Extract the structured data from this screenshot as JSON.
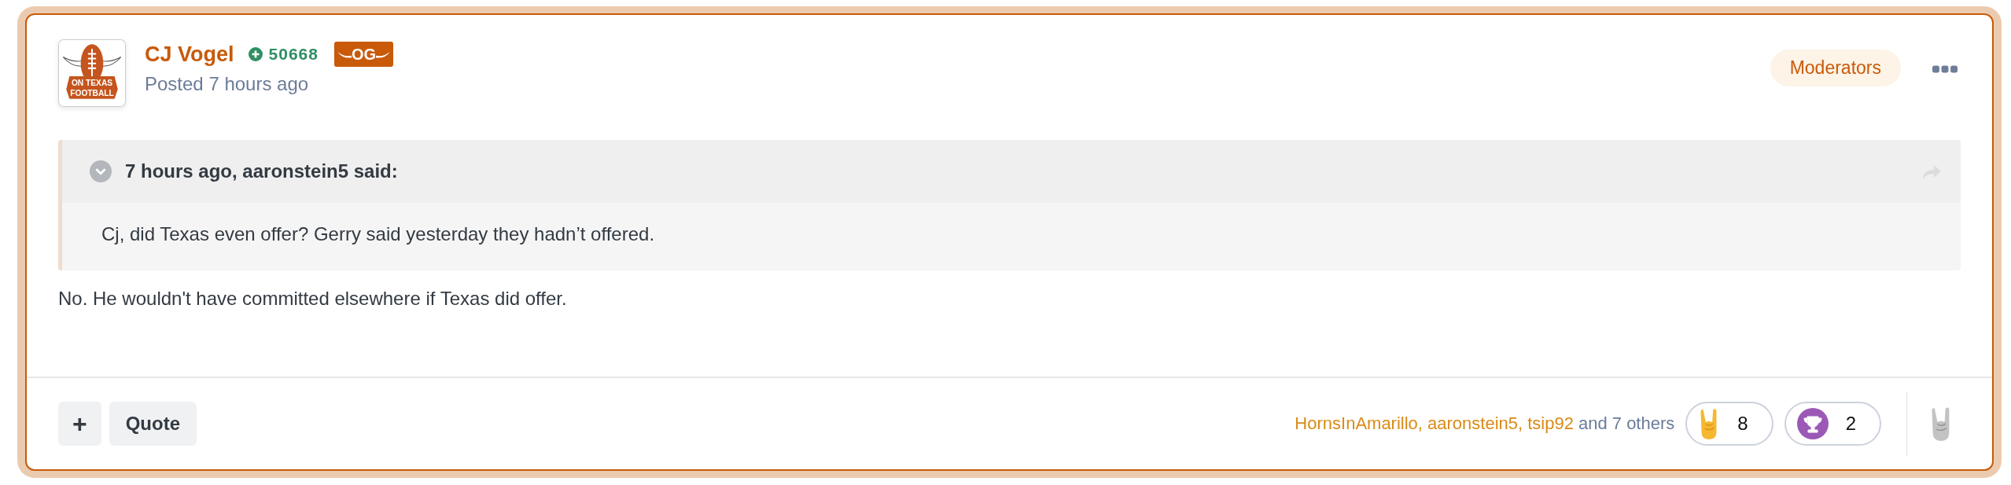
{
  "post": {
    "author": {
      "name": "CJ Vogel",
      "reputation": "50668",
      "badge": "OG",
      "posted": "Posted 7 hours ago",
      "avatar_text": [
        "ON TEXAS",
        "FOOTBALL"
      ]
    },
    "group": "Moderators",
    "quote": {
      "citation": "7 hours ago, aaronstein5 said:",
      "text": "Cj, did Texas even offer? Gerry said yesterday they hadn’t offered."
    },
    "body": "No. He wouldn't have committed elsewhere if Texas did offer.",
    "footer": {
      "buttons": [
        {
          "kind": "icon",
          "label": "+"
        },
        {
          "kind": "text",
          "label": "Quote"
        }
      ],
      "reactors": "HornsInAmarillo, aaronstein5, tsip92",
      "others": "and 7 others",
      "reactions": [
        {
          "kind": "horns",
          "count": "8"
        },
        {
          "kind": "trophy",
          "count": "2"
        }
      ]
    }
  }
}
